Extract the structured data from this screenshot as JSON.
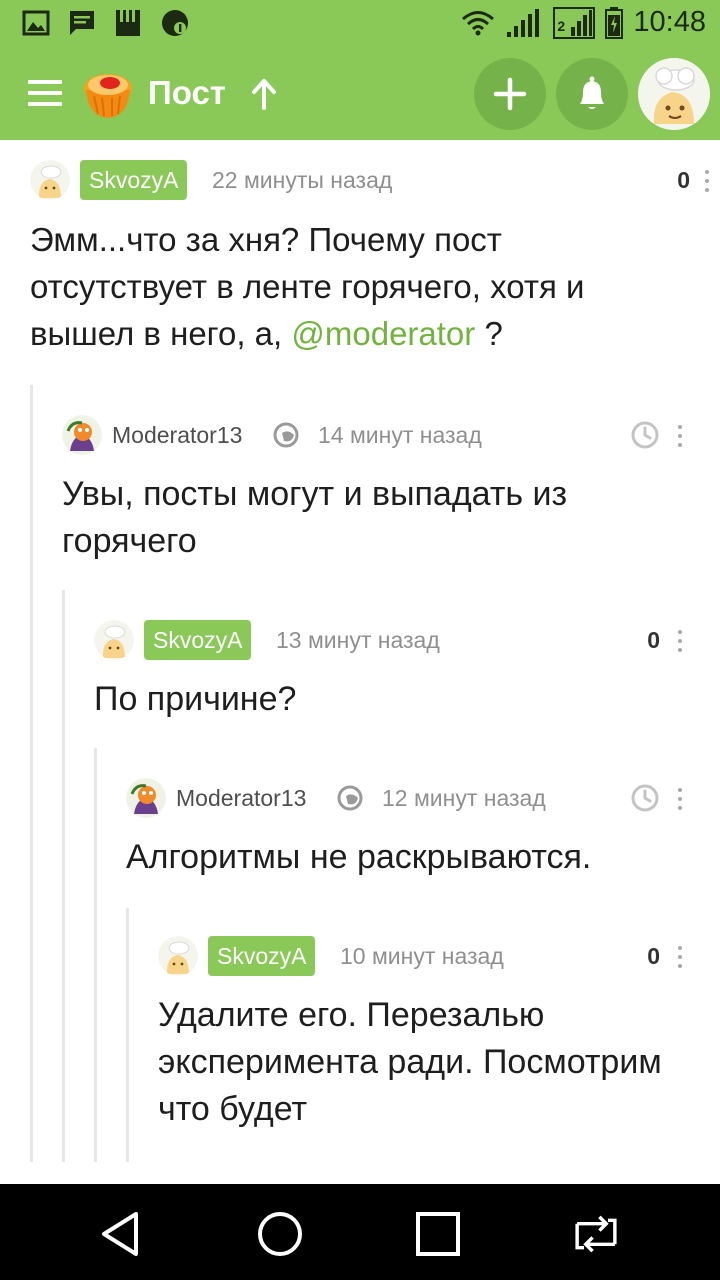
{
  "status_bar": {
    "time": "10:48",
    "sim2_label": "2"
  },
  "appbar": {
    "title": "Пост"
  },
  "comments": [
    {
      "user": "SkvozyA",
      "time": "22 минуты назад",
      "rating": "0",
      "text": "Эмм...что за хня? Почему пост отсутствует в ленте горячего, хотя и вышел в него, а, ",
      "mention": "@moderator",
      "text_after": " ?"
    },
    {
      "user": "Moderator13",
      "time": "14 минут назад",
      "text": "Увы, посты могут и выпадать из горячего"
    },
    {
      "user": "SkvozyA",
      "time": "13 минут назад",
      "rating": "0",
      "text": "По причине?"
    },
    {
      "user": "Moderator13",
      "time": "12 минут назад",
      "text": "Алгоритмы не раскрываются."
    },
    {
      "user": "SkvozyA",
      "time": "10 минут назад",
      "rating": "0",
      "text": "Удалите его. Перезалью эксперимента ради. Посмотрим что будет"
    }
  ],
  "colors": {
    "accent": "#8ac858",
    "accent_dark": "#76b24a",
    "mention": "#72b33e",
    "navbar": "#000000"
  },
  "icons": [
    "image-icon",
    "message-icon",
    "sd-card-icon",
    "sync-icon",
    "wifi-icon",
    "signal-icon",
    "battery-icon",
    "menu-icon",
    "pikabu-logo-icon",
    "arrow-up-icon",
    "plus-icon",
    "bell-icon",
    "clock-icon",
    "more-icon",
    "moderator-icon",
    "back-icon",
    "home-icon",
    "recents-icon",
    "switch-icon"
  ]
}
